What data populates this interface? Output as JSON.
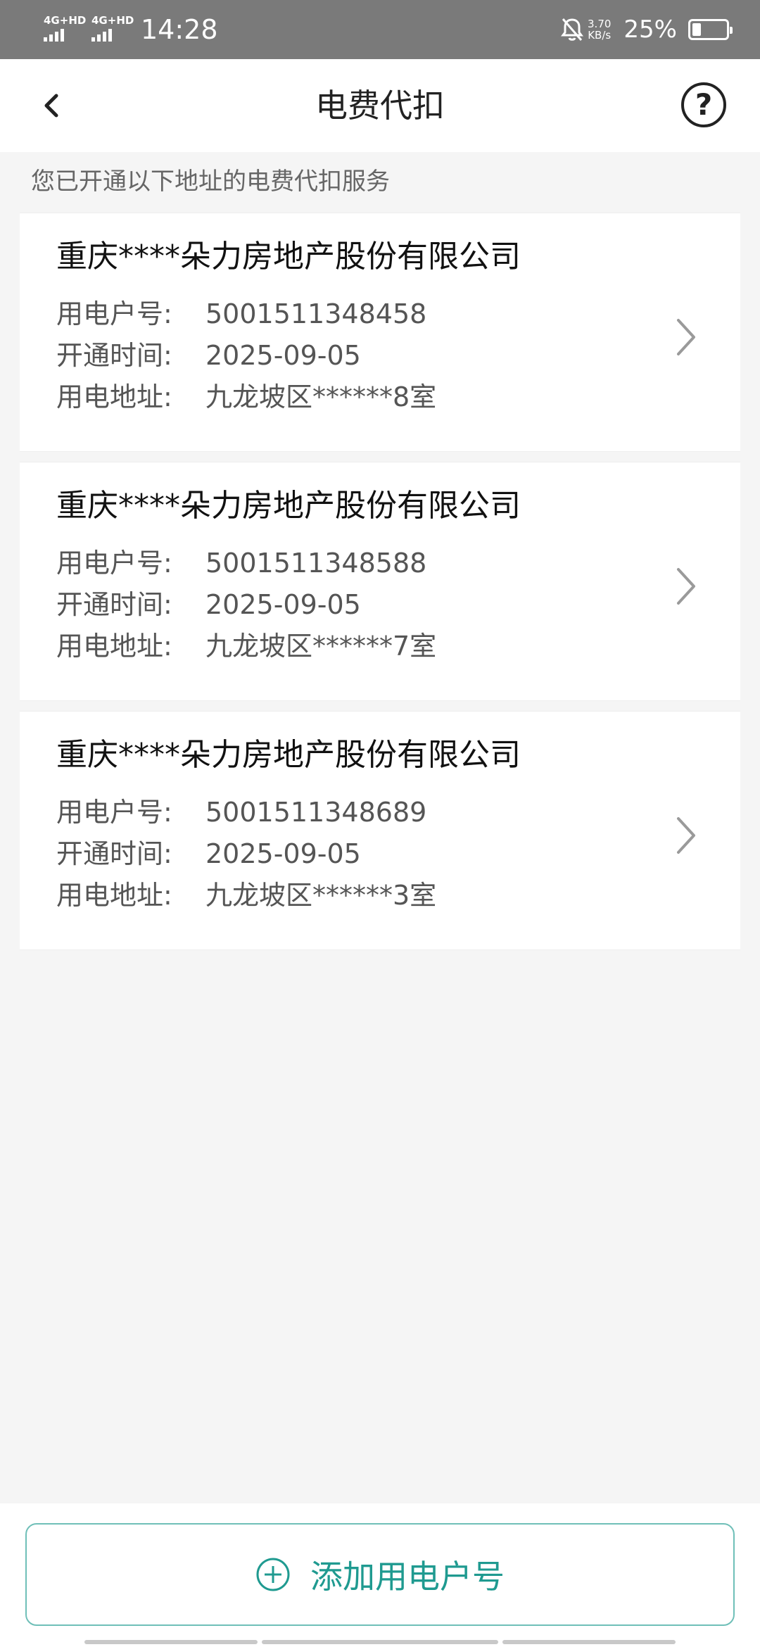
{
  "status_bar": {
    "signal1": "4G+HD",
    "signal2": "4G+HD",
    "time": "14:28",
    "speed_value": "3.70",
    "speed_unit": "KB/s",
    "battery_percent": "25%",
    "battery_level": 0.25,
    "icons": [
      "mute-bell-icon",
      "battery-icon"
    ]
  },
  "nav": {
    "title": "电费代扣",
    "back_icon": "chevron-left-icon",
    "help_icon": "question-circle-icon",
    "help_glyph": "?"
  },
  "subtitle": "您已开通以下地址的电费代扣服务",
  "labels": {
    "account": "用电户号:",
    "open_date": "开通时间:",
    "address": "用电地址:"
  },
  "accounts": [
    {
      "company": "重庆****朵力房地产股份有限公司",
      "account_no": "5001511348458",
      "open_date": "2025-09-05",
      "address": "九龙坡区******8室"
    },
    {
      "company": "重庆****朵力房地产股份有限公司",
      "account_no": "5001511348588",
      "open_date": "2025-09-05",
      "address": "九龙坡区******7室"
    },
    {
      "company": "重庆****朵力房地产股份有限公司",
      "account_no": "5001511348689",
      "open_date": "2025-09-05",
      "address": "九龙坡区******3室"
    }
  ],
  "add_button": {
    "label": "添加用电户号",
    "icon": "plus-circle-icon"
  },
  "colors": {
    "accent": "#1f9a90",
    "accent_border": "#6fbfb8",
    "status_bar_bg": "#7a7a7a",
    "page_bg": "#f5f5f5"
  }
}
